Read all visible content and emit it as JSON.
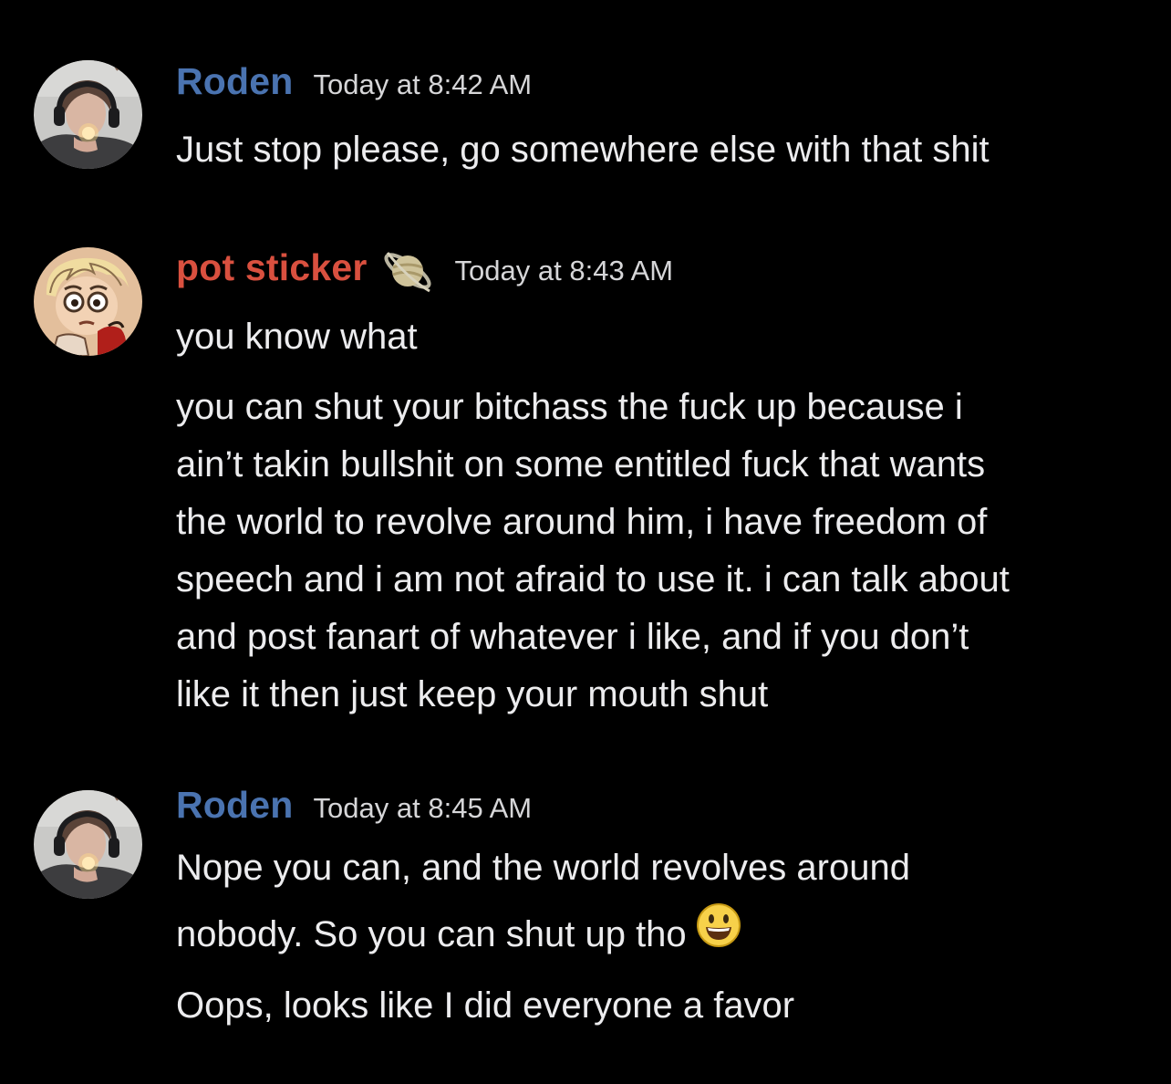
{
  "colors": {
    "background": "#000000",
    "roden_name": "#4a73b0",
    "potsticker_name": "#d9503f",
    "text": "#ececee",
    "timestamp": "#d6d6d8"
  },
  "messages": [
    {
      "author": "Roden",
      "timestamp": "Today at 8:42 AM",
      "avatar": "roden-avatar",
      "lines": [
        "Just stop please, go somewhere else with that shit"
      ]
    },
    {
      "author": "pot sticker",
      "badge": "saturn-icon",
      "timestamp": "Today at 8:43 AM",
      "avatar": "pot-sticker-avatar",
      "lines_first": [
        "you know what"
      ],
      "lines_second": [
        "you can shut your bitchass the fuck up because i",
        "ain’t takin bullshit on some entitled fuck that wants",
        "the world to revolve around him, i have freedom of",
        "speech and i am not afraid to use it. i can talk about",
        "and post fanart of whatever i like, and if you don’t",
        "like it then just keep your mouth shut"
      ]
    },
    {
      "author": "Roden",
      "timestamp": "Today at 8:45 AM",
      "avatar": "roden-avatar",
      "lines": [
        "Nope you can, and the world revolves around",
        "nobody. So you can shut up tho",
        "Oops, looks like I did everyone a favor"
      ],
      "emoji": "smiley-emoji-icon"
    }
  ]
}
